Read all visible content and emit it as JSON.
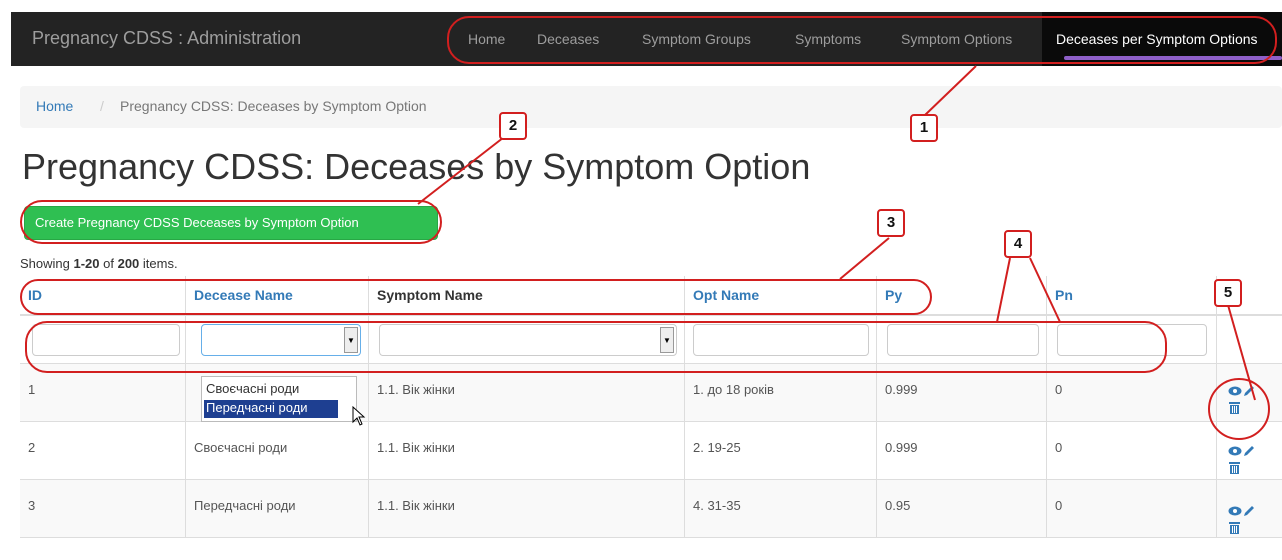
{
  "navbar": {
    "brand": "Pregnancy CDSS : Administration",
    "items": [
      {
        "label": "Home"
      },
      {
        "label": "Deceases"
      },
      {
        "label": "Symptom Groups"
      },
      {
        "label": "Symptoms"
      },
      {
        "label": "Symptom Options"
      },
      {
        "label": "Deceases per Symptom Options"
      }
    ],
    "active_index": 5
  },
  "breadcrumb": {
    "home": "Home",
    "separator": "/",
    "current": "Pregnancy CDSS: Deceases by Symptom Option"
  },
  "page": {
    "title": "Pregnancy CDSS: Deceases by Symptom Option",
    "create_button": "Create Pregnancy CDSS Deceases by Symptom Option",
    "summary_prefix": "Showing ",
    "summary_range": "1-20",
    "summary_mid": " of ",
    "summary_total": "200",
    "summary_suffix": " items."
  },
  "table": {
    "headers": [
      "ID",
      "Decease Name",
      "Symptom Name",
      "Opt Name",
      "Py",
      "Pn"
    ],
    "rows": [
      [
        "1",
        "",
        "1.1. Вік жінки",
        "1. до 18 років",
        "0.999",
        "0"
      ],
      [
        "2",
        "Своєчасні роди",
        "1.1. Вік жінки",
        "2. 19-25",
        "0.999",
        "0"
      ],
      [
        "3",
        "Передчасні роди",
        "1.1. Вік жінки",
        "4. 31-35",
        "0.95",
        "0"
      ]
    ]
  },
  "dropdown": {
    "options": [
      "Своєчасні роди",
      "Передчасні роди"
    ],
    "highlighted_index": 1
  },
  "annotations": [
    "1",
    "2",
    "3",
    "4",
    "5"
  ],
  "colors": {
    "navbar_bg": "#232323",
    "active_underline": "#8e5fc8",
    "link": "#337ab7",
    "create_button": "#2fbf52",
    "annotation": "#d21f1f"
  }
}
